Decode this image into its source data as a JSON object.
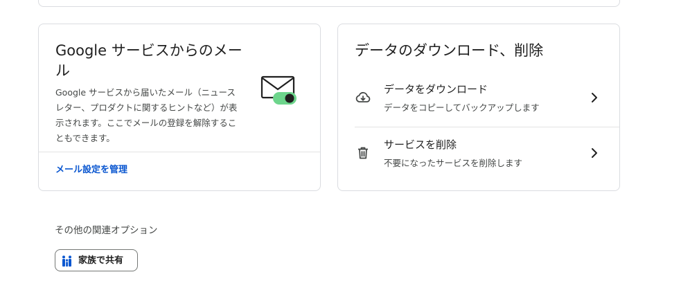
{
  "email_card": {
    "title": "Google サービスからのメール",
    "description": "Google サービスから届いたメール（ニュースレター、プロダクトに関するヒントなど）が表示されます。ここでメールの登録を解除することもできます。",
    "link_label": "メール設定を管理",
    "illustration_icon": "envelope-toggle-icon",
    "accent_color": "#0b57d0",
    "toggle_color": "#6dd58c"
  },
  "data_card": {
    "title": "データのダウンロード、削除",
    "rows": [
      {
        "icon": "cloud-download-icon",
        "title": "データをダウンロード",
        "subtitle": "データをコピーしてバックアップします"
      },
      {
        "icon": "trash-icon",
        "title": "サービスを削除",
        "subtitle": "不要になったサービスを削除します"
      }
    ]
  },
  "related": {
    "title": "その他の関連オプション",
    "chip_label": "家族で共有",
    "chip_icon": "family-icon",
    "chip_icon_color": "#0b57d0"
  }
}
